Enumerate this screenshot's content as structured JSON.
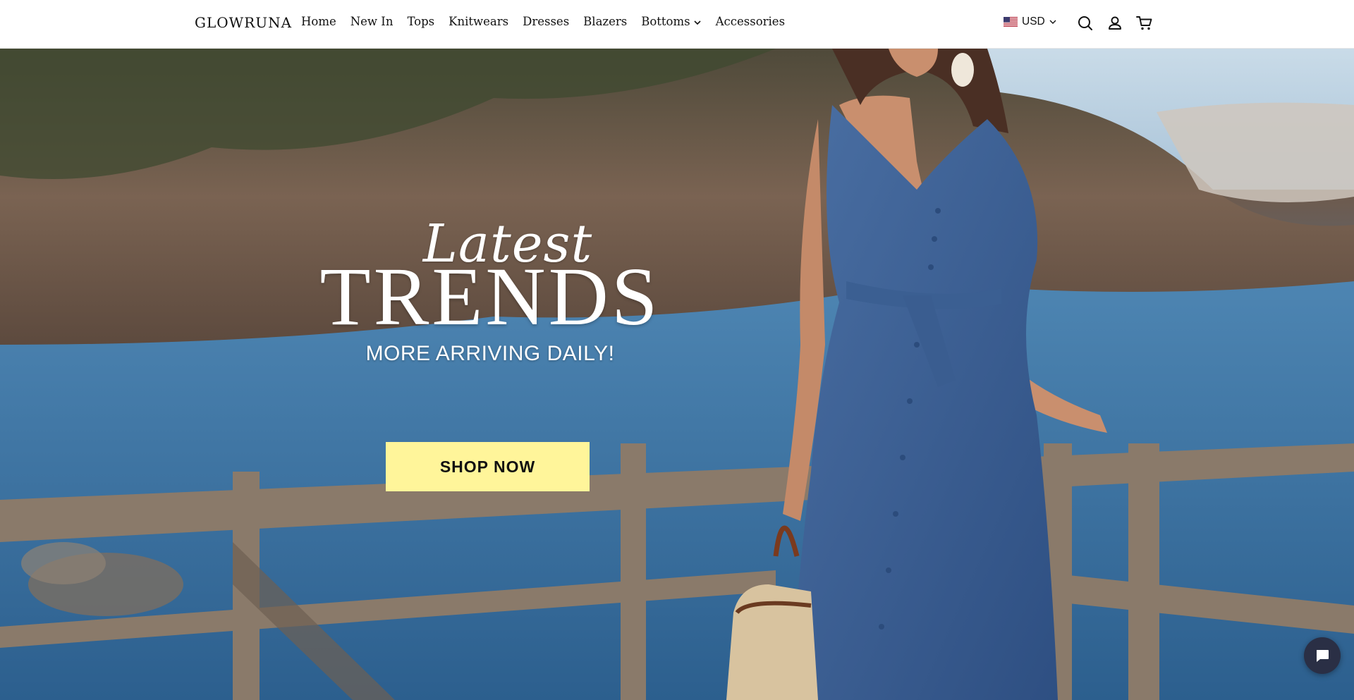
{
  "header": {
    "logo": "GLOWRUNA",
    "nav": [
      {
        "label": "Home"
      },
      {
        "label": "New In"
      },
      {
        "label": "Tops"
      },
      {
        "label": "Knitwears"
      },
      {
        "label": "Dresses"
      },
      {
        "label": "Blazers"
      },
      {
        "label": "Bottoms",
        "has_dropdown": true
      },
      {
        "label": "Accessories"
      }
    ],
    "currency": {
      "label": "USD",
      "flag_icon": "us-flag-icon"
    },
    "icons": [
      "search-icon",
      "account-icon",
      "cart-icon"
    ]
  },
  "hero": {
    "script_text": "Latest",
    "title": "TRENDS",
    "subtitle": "MORE ARRIVING DAILY!",
    "cta_label": "SHOP NOW",
    "cta_color": "#fff59a",
    "image_description_icon": "hero-photo"
  },
  "chat": {
    "icon": "chat-icon",
    "color": "#2a2f45"
  }
}
